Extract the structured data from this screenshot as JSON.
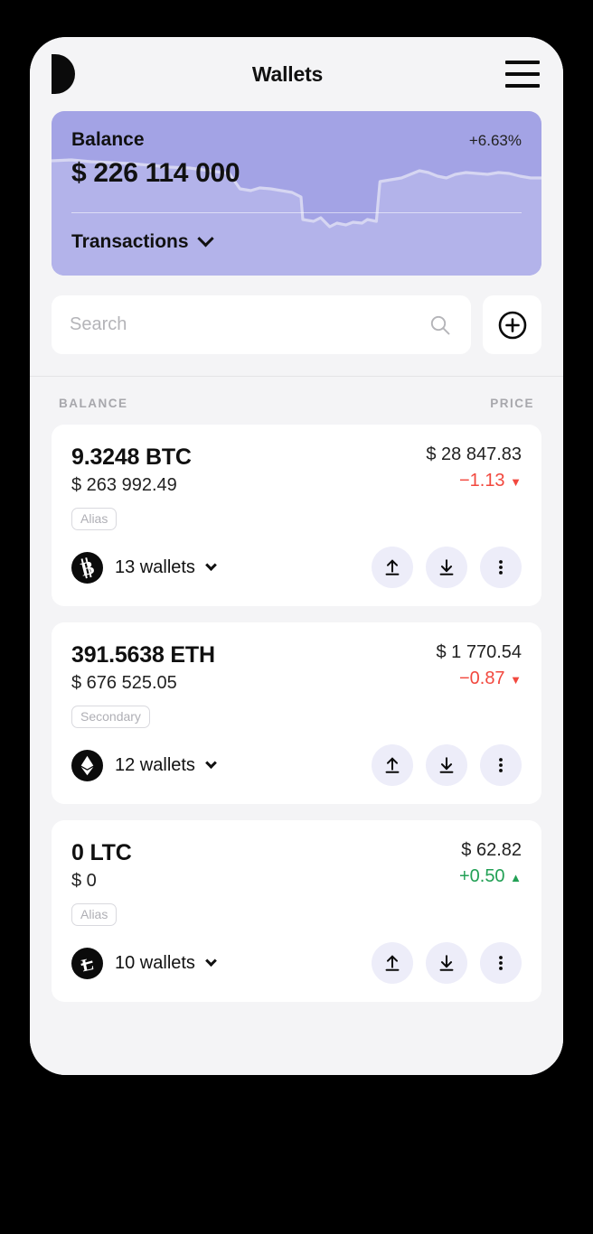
{
  "header": {
    "logo_icon": "d-logo-icon",
    "title": "Wallets",
    "menu_icon": "hamburger-menu-icon"
  },
  "balance_card": {
    "label": "Balance",
    "change": "+6.63%",
    "amount": "$ 226 114 000",
    "transactions_label": "Transactions",
    "chevron_icon": "chevron-down-icon",
    "bg_color": "#A3A3E5",
    "chart_fill_color": "#B3B3EA",
    "chart_line_color": "#D6D6F2"
  },
  "search": {
    "placeholder": "Search",
    "value": "",
    "search_icon": "search-icon",
    "add_icon": "plus-circle-icon"
  },
  "list": {
    "col_balance": "BALANCE",
    "col_price": "PRICE",
    "assets": [
      {
        "amount": "9.3248 BTC",
        "fiat": "$ 263 992.49",
        "badge": "Alias",
        "price": "$ 28 847.83",
        "delta": "−1.13",
        "delta_dir": "down",
        "delta_arrow": "▼",
        "delta_color": "#F2483E",
        "coin_icon": "bitcoin-icon",
        "wallets": "13 wallets",
        "chevron_icon": "chevron-down-icon",
        "send_icon": "upload-arrow-icon",
        "receive_icon": "download-arrow-icon",
        "more_icon": "more-vertical-icon"
      },
      {
        "amount": "391.5638 ETH",
        "fiat": "$ 676 525.05",
        "badge": "Secondary",
        "price": "$ 1 770.54",
        "delta": "−0.87",
        "delta_dir": "down",
        "delta_arrow": "▼",
        "delta_color": "#F2483E",
        "coin_icon": "ethereum-icon",
        "wallets": "12 wallets",
        "chevron_icon": "chevron-down-icon",
        "send_icon": "upload-arrow-icon",
        "receive_icon": "download-arrow-icon",
        "more_icon": "more-vertical-icon"
      },
      {
        "amount": "0 LTC",
        "fiat": "$ 0",
        "badge": "Alias",
        "price": "$ 62.82",
        "delta": "+0.50",
        "delta_dir": "up",
        "delta_arrow": "▲",
        "delta_color": "#22A055",
        "coin_icon": "litecoin-icon",
        "wallets": "10 wallets",
        "chevron_icon": "chevron-down-icon",
        "send_icon": "upload-arrow-icon",
        "receive_icon": "download-arrow-icon",
        "more_icon": "more-vertical-icon"
      }
    ]
  }
}
